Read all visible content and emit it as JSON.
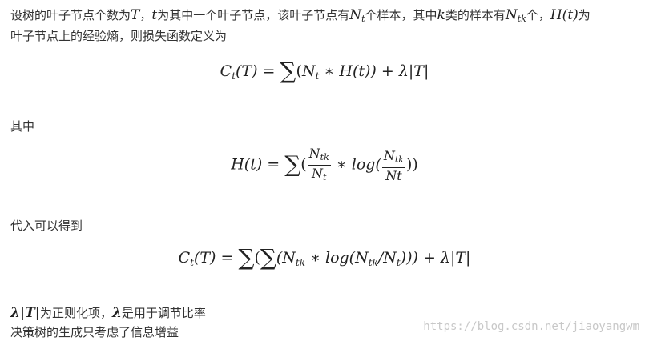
{
  "intro": {
    "l1_a": "设树的叶子节点个数为",
    "sym_T": "T",
    "l1_b": "，",
    "sym_t": "t",
    "l1_c": "为其中一个叶子节点，该叶子节点有",
    "sym_N": "N",
    "sym_sub_t": "t",
    "l1_d": "个样本，其中",
    "sym_k": "k",
    "l1_e": "类的样本有",
    "sym_N2": "N",
    "sym_sub_tk": "tk",
    "l1_f": "个，",
    "sym_Ht": "H(t)",
    "l1_g": "为",
    "line2": "叶子节点上的经验熵，则损失函数定义为"
  },
  "eq1": {
    "C": "C",
    "sub_t": "t",
    "arg": "(T) = ",
    "sum": "∑",
    "p1": "(",
    "N": "N",
    "sub_t2": "t",
    "p2": " ∗ H(t)) + λ|T|"
  },
  "among": "其中",
  "eq2": {
    "lhs": "H(t) = ",
    "sum": "∑",
    "open": "(",
    "f1_num_N": "N",
    "f1_num_sub": "tk",
    "f1_den_N": "N",
    "f1_den_sub": "t",
    "mid": " ∗ log(",
    "f2_num_N": "N",
    "f2_num_sub": "tk",
    "f2_den": "Nt",
    "close": "))"
  },
  "substitute": "代入可以得到",
  "eq3": {
    "C": "C",
    "sub_t": "t",
    "arg": "(T) = ",
    "sum1": "∑",
    "open": "(",
    "sum2": "∑",
    "p1": "(N",
    "sub_tk1": "tk",
    "p2": " ∗ log(N",
    "sub_tk2": "tk",
    "p3": "/N",
    "sub_t3": "t",
    "p4": "))) + λ|T|"
  },
  "outro": {
    "sym_lT": "λ|T|",
    "l1_a": "为正则化项，",
    "sym_l": "λ",
    "l1_b": "是用于调节比率",
    "line2": "决策树的生成只考虑了信息增益"
  },
  "watermark": "https://blog.csdn.net/jiaoyangwm"
}
